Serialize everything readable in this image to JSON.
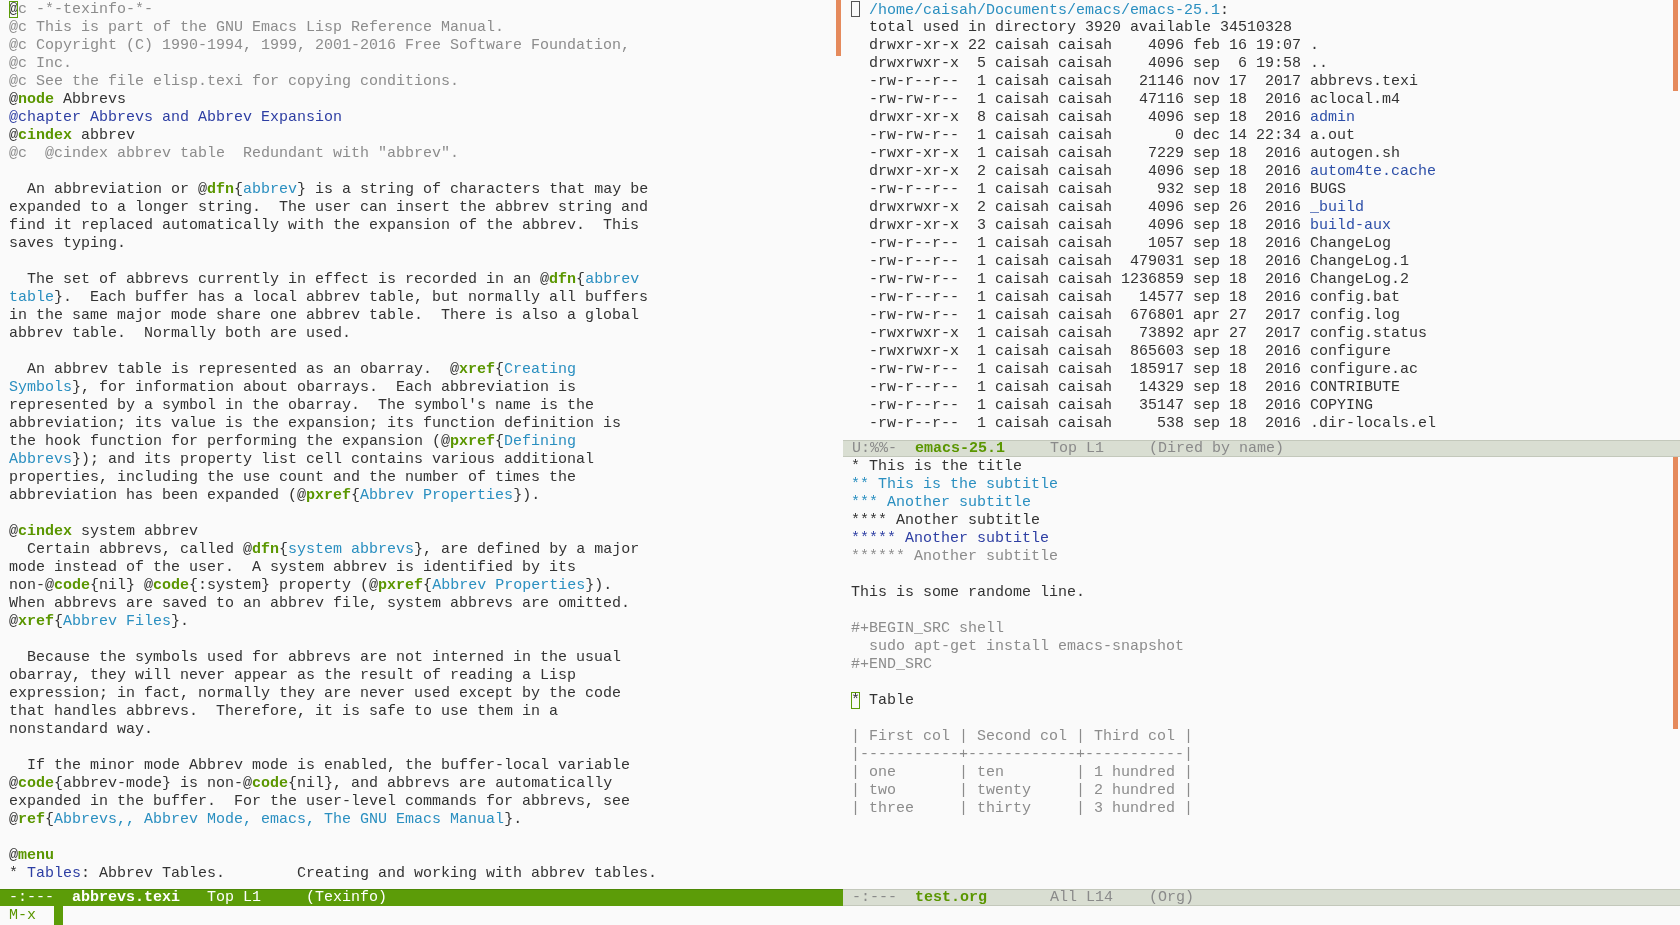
{
  "editor": {
    "blocks": [
      {
        "lines": [
          {
            "segments": [
              {
                "kind": "cursor",
                "text": "@"
              },
              {
                "kind": "comment",
                "text": "c -*-texinfo-*-"
              }
            ]
          },
          {
            "segments": [
              {
                "kind": "comment",
                "text": "@c This is part of the GNU Emacs Lisp Reference Manual."
              }
            ]
          },
          {
            "segments": [
              {
                "kind": "comment",
                "text": "@c Copyright (C) 1990-1994, 1999, 2001-2016 Free Software Foundation,"
              }
            ]
          },
          {
            "segments": [
              {
                "kind": "comment",
                "text": "@c Inc."
              }
            ]
          },
          {
            "segments": [
              {
                "kind": "comment",
                "text": "@c See the file elisp.texi for copying conditions."
              }
            ]
          },
          {
            "segments": [
              {
                "kind": "text",
                "text": "@"
              },
              {
                "kind": "keyword",
                "text": "node"
              },
              {
                "kind": "text",
                "text": " Abbrevs"
              }
            ]
          },
          {
            "segments": [
              {
                "kind": "heading",
                "text": "@chapter Abbrevs and Abbrev Expansion"
              }
            ]
          },
          {
            "segments": [
              {
                "kind": "text",
                "text": "@"
              },
              {
                "kind": "keyword",
                "text": "cindex"
              },
              {
                "kind": "text",
                "text": " abbrev"
              }
            ]
          },
          {
            "segments": [
              {
                "kind": "comment",
                "text": "@c  @cindex abbrev table  Redundant with \"abbrev\"."
              }
            ]
          }
        ]
      },
      {
        "lines": [
          {
            "segments": [
              {
                "kind": "text",
                "text": "  An abbreviation or @"
              },
              {
                "kind": "keyword",
                "text": "dfn"
              },
              {
                "kind": "text",
                "text": "{"
              },
              {
                "kind": "link",
                "text": "abbrev"
              },
              {
                "kind": "text",
                "text": "} is a string of characters that may be"
              }
            ]
          },
          {
            "segments": [
              {
                "kind": "text",
                "text": "expanded to a longer string.  The user can insert the abbrev string and"
              }
            ]
          },
          {
            "segments": [
              {
                "kind": "text",
                "text": "find it replaced automatically with the expansion of the abbrev.  This"
              }
            ]
          },
          {
            "segments": [
              {
                "kind": "text",
                "text": "saves typing."
              }
            ]
          }
        ]
      },
      {
        "lines": [
          {
            "segments": [
              {
                "kind": "text",
                "text": "  The set of abbrevs currently in effect is recorded in an @"
              },
              {
                "kind": "keyword",
                "text": "dfn"
              },
              {
                "kind": "text",
                "text": "{"
              },
              {
                "kind": "link",
                "text": "abbrev"
              }
            ]
          },
          {
            "segments": [
              {
                "kind": "link",
                "text": "table"
              },
              {
                "kind": "text",
                "text": "}.  Each buffer has a local abbrev table, but normally all buffers"
              }
            ]
          },
          {
            "segments": [
              {
                "kind": "text",
                "text": "in the same major mode share one abbrev table.  There is also a global"
              }
            ]
          },
          {
            "segments": [
              {
                "kind": "text",
                "text": "abbrev table.  Normally both are used."
              }
            ]
          }
        ]
      },
      {
        "lines": [
          {
            "segments": [
              {
                "kind": "text",
                "text": "  An abbrev table is represented as an obarray.  @"
              },
              {
                "kind": "keyword",
                "text": "xref"
              },
              {
                "kind": "text",
                "text": "{"
              },
              {
                "kind": "link",
                "text": "Creating"
              }
            ]
          },
          {
            "segments": [
              {
                "kind": "link",
                "text": "Symbols"
              },
              {
                "kind": "text",
                "text": "}, for information about obarrays.  Each abbreviation is"
              }
            ]
          },
          {
            "segments": [
              {
                "kind": "text",
                "text": "represented by a symbol in the obarray.  The symbol's name is the"
              }
            ]
          },
          {
            "segments": [
              {
                "kind": "text",
                "text": "abbreviation; its value is the expansion; its function definition is"
              }
            ]
          },
          {
            "segments": [
              {
                "kind": "text",
                "text": "the hook function for performing the expansion (@"
              },
              {
                "kind": "keyword",
                "text": "pxref"
              },
              {
                "kind": "text",
                "text": "{"
              },
              {
                "kind": "link",
                "text": "Defining"
              }
            ]
          },
          {
            "segments": [
              {
                "kind": "link",
                "text": "Abbrevs"
              },
              {
                "kind": "text",
                "text": "}); and its property list cell contains various additional"
              }
            ]
          },
          {
            "segments": [
              {
                "kind": "text",
                "text": "properties, including the use count and the number of times the"
              }
            ]
          },
          {
            "segments": [
              {
                "kind": "text",
                "text": "abbreviation has been expanded (@"
              },
              {
                "kind": "keyword",
                "text": "pxref"
              },
              {
                "kind": "text",
                "text": "{"
              },
              {
                "kind": "link",
                "text": "Abbrev Properties"
              },
              {
                "kind": "text",
                "text": "})."
              }
            ]
          }
        ]
      },
      {
        "lines": [
          {
            "segments": [
              {
                "kind": "text",
                "text": "@"
              },
              {
                "kind": "keyword",
                "text": "cindex"
              },
              {
                "kind": "text",
                "text": " system abbrev"
              }
            ]
          },
          {
            "segments": [
              {
                "kind": "text",
                "text": "  Certain abbrevs, called @"
              },
              {
                "kind": "keyword",
                "text": "dfn"
              },
              {
                "kind": "text",
                "text": "{"
              },
              {
                "kind": "link",
                "text": "system abbrevs"
              },
              {
                "kind": "text",
                "text": "}, are defined by a major"
              }
            ]
          },
          {
            "segments": [
              {
                "kind": "text",
                "text": "mode instead of the user.  A system abbrev is identified by its"
              }
            ]
          },
          {
            "segments": [
              {
                "kind": "text",
                "text": "non-@"
              },
              {
                "kind": "keyword",
                "text": "code"
              },
              {
                "kind": "text",
                "text": "{nil} @"
              },
              {
                "kind": "keyword",
                "text": "code"
              },
              {
                "kind": "text",
                "text": "{:system} property (@"
              },
              {
                "kind": "keyword",
                "text": "pxref"
              },
              {
                "kind": "text",
                "text": "{"
              },
              {
                "kind": "link",
                "text": "Abbrev Properties"
              },
              {
                "kind": "text",
                "text": "})."
              }
            ]
          },
          {
            "segments": [
              {
                "kind": "text",
                "text": "When abbrevs are saved to an abbrev file, system abbrevs are omitted."
              }
            ]
          },
          {
            "segments": [
              {
                "kind": "text",
                "text": "@"
              },
              {
                "kind": "keyword",
                "text": "xref"
              },
              {
                "kind": "text",
                "text": "{"
              },
              {
                "kind": "link",
                "text": "Abbrev Files"
              },
              {
                "kind": "text",
                "text": "}."
              }
            ]
          }
        ]
      },
      {
        "lines": [
          {
            "segments": [
              {
                "kind": "text",
                "text": "  Because the symbols used for abbrevs are not interned in the usual"
              }
            ]
          },
          {
            "segments": [
              {
                "kind": "text",
                "text": "obarray, they will never appear as the result of reading a Lisp"
              }
            ]
          },
          {
            "segments": [
              {
                "kind": "text",
                "text": "expression; in fact, normally they are never used except by the code"
              }
            ]
          },
          {
            "segments": [
              {
                "kind": "text",
                "text": "that handles abbrevs.  Therefore, it is safe to use them in a"
              }
            ]
          },
          {
            "segments": [
              {
                "kind": "text",
                "text": "nonstandard way."
              }
            ]
          }
        ]
      },
      {
        "lines": [
          {
            "segments": [
              {
                "kind": "text",
                "text": "  If the minor mode Abbrev mode is enabled, the buffer-local variable"
              }
            ]
          },
          {
            "segments": [
              {
                "kind": "text",
                "text": "@"
              },
              {
                "kind": "keyword",
                "text": "code"
              },
              {
                "kind": "text",
                "text": "{abbrev-mode} is non-@"
              },
              {
                "kind": "keyword",
                "text": "code"
              },
              {
                "kind": "text",
                "text": "{nil}, and abbrevs are automatically"
              }
            ]
          },
          {
            "segments": [
              {
                "kind": "text",
                "text": "expanded in the buffer.  For the user-level commands for abbrevs, see"
              }
            ]
          },
          {
            "segments": [
              {
                "kind": "text",
                "text": "@"
              },
              {
                "kind": "keyword",
                "text": "ref"
              },
              {
                "kind": "text",
                "text": "{"
              },
              {
                "kind": "link",
                "text": "Abbrevs,, Abbrev Mode, emacs, The GNU Emacs Manual"
              },
              {
                "kind": "text",
                "text": "}."
              }
            ]
          }
        ]
      },
      {
        "lines": [
          {
            "segments": [
              {
                "kind": "text",
                "text": "@"
              },
              {
                "kind": "keyword",
                "text": "menu"
              }
            ]
          },
          {
            "segments": [
              {
                "kind": "text",
                "text": "* "
              },
              {
                "kind": "heading",
                "text": "Tables"
              },
              {
                "kind": "text",
                "text": ": Abbrev Tables.        Creating and working with abbrev tables."
              }
            ]
          }
        ]
      }
    ],
    "mode_line": {
      "status": "-:---",
      "buffer": "abbrevs.texi",
      "position": "Top L1",
      "mode": "(Texinfo)",
      "active": true
    }
  },
  "dired": {
    "cursor": true,
    "path": "/home/caisah/Documents/emacs/emacs-25.1",
    "path_suffix": ":",
    "total": "total used in directory 3920 available 34510328",
    "entries": [
      {
        "listing": "drwxr-xr-x 22 caisah caisah    4096 feb 16 19:07 ",
        "name": ".",
        "kind": "file"
      },
      {
        "listing": "drwxrwxr-x  5 caisah caisah    4096 sep  6 19:58 ",
        "name": "..",
        "kind": "file"
      },
      {
        "listing": "-rw-r--r--  1 caisah caisah   21146 nov 17  2017 ",
        "name": "abbrevs.texi",
        "kind": "file"
      },
      {
        "listing": "-rw-rw-r--  1 caisah caisah   47116 sep 18  2016 ",
        "name": "aclocal.m4",
        "kind": "file"
      },
      {
        "listing": "drwxr-xr-x  8 caisah caisah    4096 sep 18  2016 ",
        "name": "admin",
        "kind": "dir"
      },
      {
        "listing": "-rw-rw-r--  1 caisah caisah       0 dec 14 22:34 ",
        "name": "a.out",
        "kind": "file"
      },
      {
        "listing": "-rwxr-xr-x  1 caisah caisah    7229 sep 18  2016 ",
        "name": "autogen.sh",
        "kind": "file"
      },
      {
        "listing": "drwxr-xr-x  2 caisah caisah    4096 sep 18  2016 ",
        "name": "autom4te.cache",
        "kind": "dir"
      },
      {
        "listing": "-rw-r--r--  1 caisah caisah     932 sep 18  2016 ",
        "name": "BUGS",
        "kind": "file"
      },
      {
        "listing": "drwxrwxr-x  2 caisah caisah    4096 sep 26  2016 ",
        "name": "_build",
        "kind": "dir"
      },
      {
        "listing": "drwxr-xr-x  3 caisah caisah    4096 sep 18  2016 ",
        "name": "build-aux",
        "kind": "dir"
      },
      {
        "listing": "-rw-r--r--  1 caisah caisah    1057 sep 18  2016 ",
        "name": "ChangeLog",
        "kind": "file"
      },
      {
        "listing": "-rw-r--r--  1 caisah caisah  479031 sep 18  2016 ",
        "name": "ChangeLog.1",
        "kind": "file"
      },
      {
        "listing": "-rw-rw-r--  1 caisah caisah 1236859 sep 18  2016 ",
        "name": "ChangeLog.2",
        "kind": "file"
      },
      {
        "listing": "-rw-r--r--  1 caisah caisah   14577 sep 18  2016 ",
        "name": "config.bat",
        "kind": "file"
      },
      {
        "listing": "-rw-rw-r--  1 caisah caisah  676801 apr 27  2017 ",
        "name": "config.log",
        "kind": "file"
      },
      {
        "listing": "-rwxrwxr-x  1 caisah caisah   73892 apr 27  2017 ",
        "name": "config.status",
        "kind": "file"
      },
      {
        "listing": "-rwxrwxr-x  1 caisah caisah  865603 sep 18  2016 ",
        "name": "configure",
        "kind": "file"
      },
      {
        "listing": "-rw-rw-r--  1 caisah caisah  185917 sep 18  2016 ",
        "name": "configure.ac",
        "kind": "file"
      },
      {
        "listing": "-rw-r--r--  1 caisah caisah   14329 sep 18  2016 ",
        "name": "CONTRIBUTE",
        "kind": "file"
      },
      {
        "listing": "-rw-r--r--  1 caisah caisah   35147 sep 18  2016 ",
        "name": "COPYING",
        "kind": "file"
      },
      {
        "listing": "-rw-r--r--  1 caisah caisah     538 sep 18  2016 ",
        "name": ".dir-locals.el",
        "kind": "file"
      }
    ],
    "mode_line": {
      "status": "U:%%-",
      "buffer": "emacs-25.1",
      "position": "Top L1",
      "mode": "(Dired by name)",
      "active": false
    }
  },
  "org": {
    "blocks": [
      {
        "lines": [
          {
            "segments": [
              {
                "kind": "text",
                "text": "* This is the title"
              }
            ]
          },
          {
            "segments": [
              {
                "kind": "link",
                "text": "** This is the subtitle"
              }
            ]
          },
          {
            "segments": [
              {
                "kind": "link",
                "text": "*** Another subtitle"
              }
            ]
          },
          {
            "segments": [
              {
                "kind": "text",
                "text": "**** Another subtitle"
              }
            ]
          },
          {
            "segments": [
              {
                "kind": "heading",
                "text": "***** Another subtitle"
              }
            ]
          },
          {
            "segments": [
              {
                "kind": "comment",
                "text": "****** Another subtitle"
              }
            ]
          }
        ]
      },
      {
        "lines": [
          {
            "segments": [
              {
                "kind": "text",
                "text": "This is some randome line."
              }
            ]
          }
        ]
      },
      {
        "lines": [
          {
            "segments": [
              {
                "kind": "comment",
                "text": "#+BEGIN_SRC shell"
              }
            ]
          },
          {
            "segments": [
              {
                "kind": "comment",
                "text": "  sudo apt-get install emacs-snapshot"
              }
            ]
          },
          {
            "segments": [
              {
                "kind": "comment",
                "text": "#+END_SRC"
              }
            ]
          }
        ]
      },
      {
        "lines": [
          {
            "segments": [
              {
                "kind": "cursor",
                "text": "*"
              },
              {
                "kind": "text",
                "text": " Table"
              }
            ]
          }
        ]
      },
      {
        "lines": [
          {
            "segments": [
              {
                "kind": "comment",
                "text": "| First col | Second col | Third col |"
              }
            ]
          },
          {
            "segments": [
              {
                "kind": "comment",
                "text": "|-----------+------------+-----------|"
              }
            ]
          },
          {
            "segments": [
              {
                "kind": "comment",
                "text": "| one       | ten        | 1 hundred |"
              }
            ]
          },
          {
            "segments": [
              {
                "kind": "comment",
                "text": "| two       | twenty     | 2 hundred |"
              }
            ]
          },
          {
            "segments": [
              {
                "kind": "comment",
                "text": "| three     | thirty     | 3 hundred |"
              }
            ]
          }
        ]
      }
    ],
    "mode_line": {
      "status": "-:---",
      "buffer": "test.org",
      "position": "All L14",
      "mode": "(Org)",
      "active": false
    }
  },
  "minibuffer": {
    "prompt": "M-x"
  }
}
